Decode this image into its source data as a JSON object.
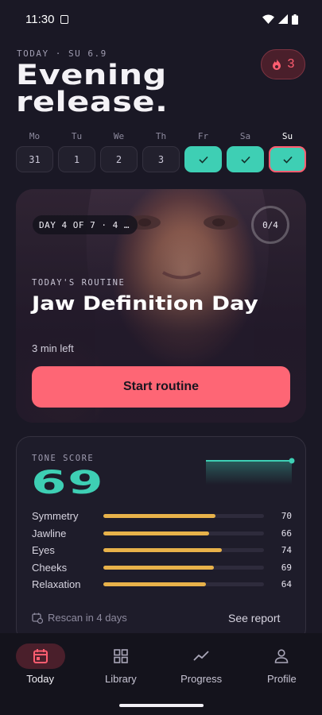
{
  "status_bar": {
    "time": "11:30"
  },
  "header": {
    "date": "TODAY · SU 6.9",
    "title": "Evening release.",
    "streak": "3"
  },
  "week": [
    {
      "label": "Mo",
      "value": "31",
      "state": "plain"
    },
    {
      "label": "Tu",
      "value": "1",
      "state": "plain"
    },
    {
      "label": "We",
      "value": "2",
      "state": "plain"
    },
    {
      "label": "Th",
      "value": "3",
      "state": "plain"
    },
    {
      "label": "Fr",
      "value": "",
      "state": "done"
    },
    {
      "label": "Sa",
      "value": "",
      "state": "done"
    },
    {
      "label": "Su",
      "value": "",
      "state": "today"
    }
  ],
  "routine": {
    "pill": "DAY 4 OF 7 · 4 …",
    "progress": "0/4",
    "eyebrow": "TODAY'S ROUTINE",
    "title": "Jaw Definition Day",
    "time_left": "3 min left",
    "button": "Start routine"
  },
  "score": {
    "label": "TONE SCORE",
    "value": "69",
    "metrics": [
      {
        "name": "Symmetry",
        "value": 70
      },
      {
        "name": "Jawline",
        "value": 66
      },
      {
        "name": "Eyes",
        "value": 74
      },
      {
        "name": "Cheeks",
        "value": 69
      },
      {
        "name": "Relaxation",
        "value": 64
      }
    ],
    "rescan": "Rescan in 4 days",
    "report": "See report"
  },
  "nav": [
    {
      "label": "Today",
      "icon": "calendar-icon",
      "active": true
    },
    {
      "label": "Library",
      "icon": "grid-icon",
      "active": false
    },
    {
      "label": "Progress",
      "icon": "trend-icon",
      "active": false
    },
    {
      "label": "Profile",
      "icon": "person-icon",
      "active": false
    }
  ],
  "colors": {
    "accent_teal": "#3ecfb4",
    "accent_coral": "#fe6675",
    "bar_yellow": "#e8b24a",
    "background": "#1a1825"
  }
}
